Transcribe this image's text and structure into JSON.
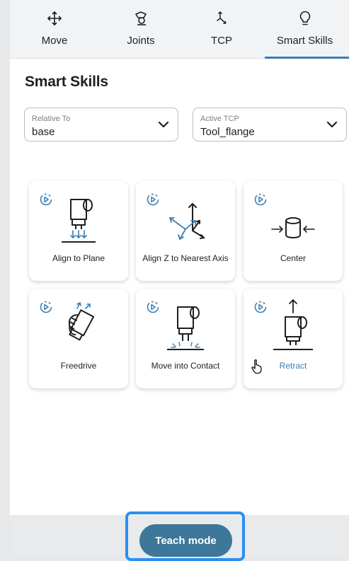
{
  "tabs": [
    {
      "label": "Move",
      "icon": "move-arrows-icon"
    },
    {
      "label": "Joints",
      "icon": "joint-icon"
    },
    {
      "label": "TCP",
      "icon": "tcp-axes-icon"
    },
    {
      "label": "Smart Skills",
      "icon": "lightbulb-icon",
      "active": true
    }
  ],
  "page_title": "Smart Skills",
  "relative_to": {
    "label": "Relative To",
    "value": "base"
  },
  "active_tcp": {
    "label": "Active TCP",
    "value": "Tool_flange"
  },
  "skills": [
    {
      "label": "Align to Plane",
      "icon": "align-to-plane-icon"
    },
    {
      "label": "Align Z to Nearest Axis",
      "icon": "align-z-axis-icon"
    },
    {
      "label": "Center",
      "icon": "center-icon"
    },
    {
      "label": "Freedrive",
      "icon": "freedrive-hand-icon"
    },
    {
      "label": "Move into Contact",
      "icon": "move-into-contact-icon"
    },
    {
      "label": "Retract",
      "icon": "retract-icon",
      "hovered": true
    }
  ],
  "teach_mode_label": "Teach mode",
  "colors": {
    "accent": "#3a7fb5",
    "teach_button": "#3d7799",
    "focus_ring": "#2b8ff0"
  }
}
